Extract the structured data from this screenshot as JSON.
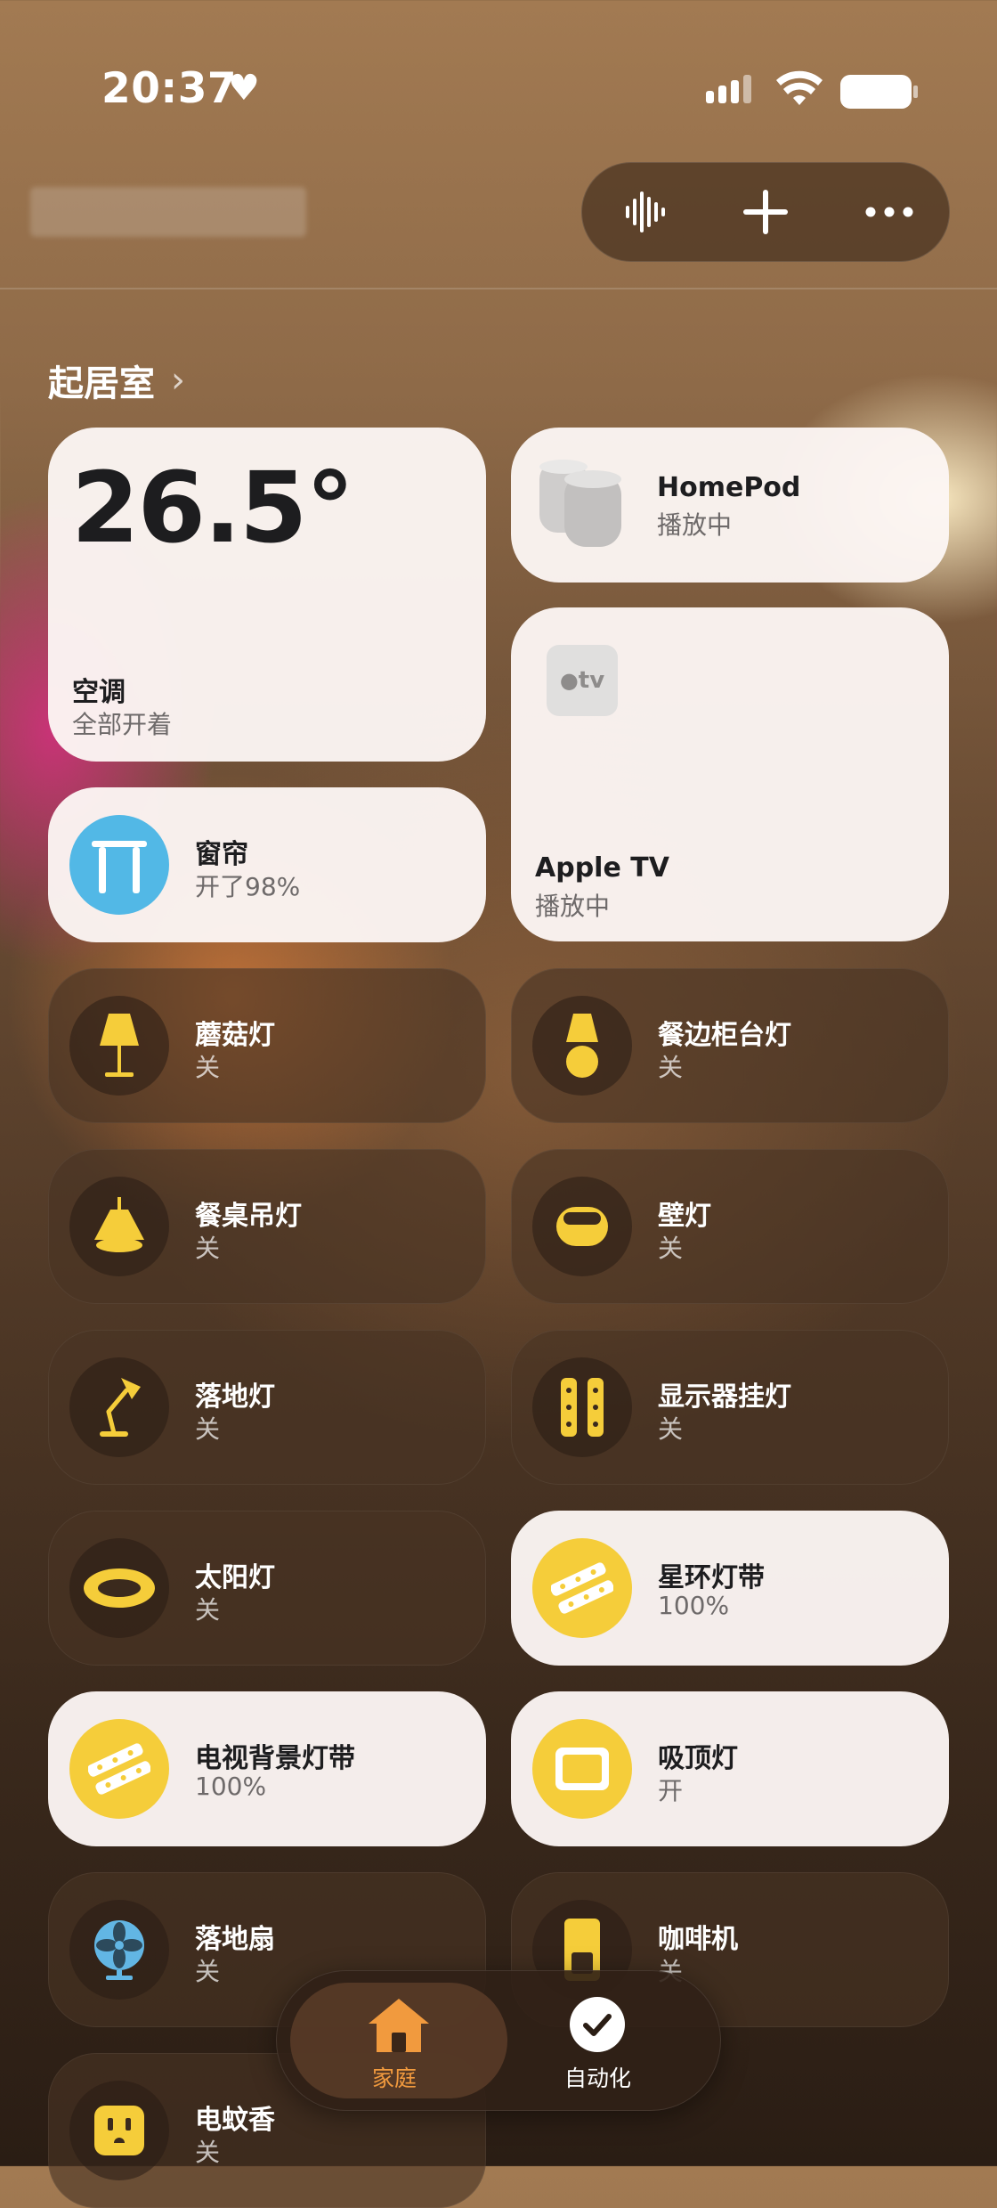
{
  "status_bar": {
    "time": "20:37"
  },
  "header": {
    "icons": [
      "voice-waveform-icon",
      "plus-icon",
      "more-icon"
    ]
  },
  "room": {
    "title": "起居室"
  },
  "tiles": [
    {
      "name": "空调",
      "state": "全部开着",
      "value": "26.5°",
      "icon": "thermostat",
      "on": true
    },
    {
      "name": "HomePod",
      "state": "播放中",
      "icon": "homepod-icon",
      "on": true
    },
    {
      "name": "Apple TV",
      "state": "播放中",
      "icon": "appletv-icon",
      "icon_text": "tv",
      "on": true
    },
    {
      "name": "窗帘",
      "state": "开了98%",
      "icon": "curtain-icon",
      "on": true
    },
    {
      "name": "蘑菇灯",
      "state": "关",
      "icon": "table-lamp-icon",
      "on": false
    },
    {
      "name": "餐边柜台灯",
      "state": "关",
      "icon": "lamp-icon",
      "on": false
    },
    {
      "name": "餐桌吊灯",
      "state": "关",
      "icon": "pendant-lamp-icon",
      "on": false
    },
    {
      "name": "壁灯",
      "state": "关",
      "icon": "wall-light-icon",
      "on": false
    },
    {
      "name": "落地灯",
      "state": "关",
      "icon": "desk-lamp-icon",
      "on": false
    },
    {
      "name": "显示器挂灯",
      "state": "关",
      "icon": "light-strip-icon",
      "on": false
    },
    {
      "name": "太阳灯",
      "state": "关",
      "icon": "ring-light-icon",
      "on": false
    },
    {
      "name": "星环灯带",
      "state": "100%",
      "icon": "light-strip-icon",
      "on": true
    },
    {
      "name": "电视背景灯带",
      "state": "100%",
      "icon": "light-strip-icon",
      "on": true
    },
    {
      "name": "吸顶灯",
      "state": "开",
      "icon": "ceiling-light-icon",
      "on": true
    },
    {
      "name": "落地扇",
      "state": "关",
      "icon": "fan-icon",
      "on": false
    },
    {
      "name": "咖啡机",
      "state": "关",
      "icon": "coffee-machine-icon",
      "on": false
    },
    {
      "name": "电蚊香",
      "state": "关",
      "icon": "outlet-icon",
      "on": false
    }
  ],
  "tabbar": {
    "tabs": [
      {
        "label": "家庭",
        "icon": "home-icon",
        "active": true
      },
      {
        "label": "自动化",
        "icon": "automation-clock-icon",
        "active": false
      }
    ]
  },
  "colors": {
    "accent_on": "#f5cd3a",
    "curtain_blue": "#52b8e6",
    "tab_active": "#f19a3e"
  }
}
